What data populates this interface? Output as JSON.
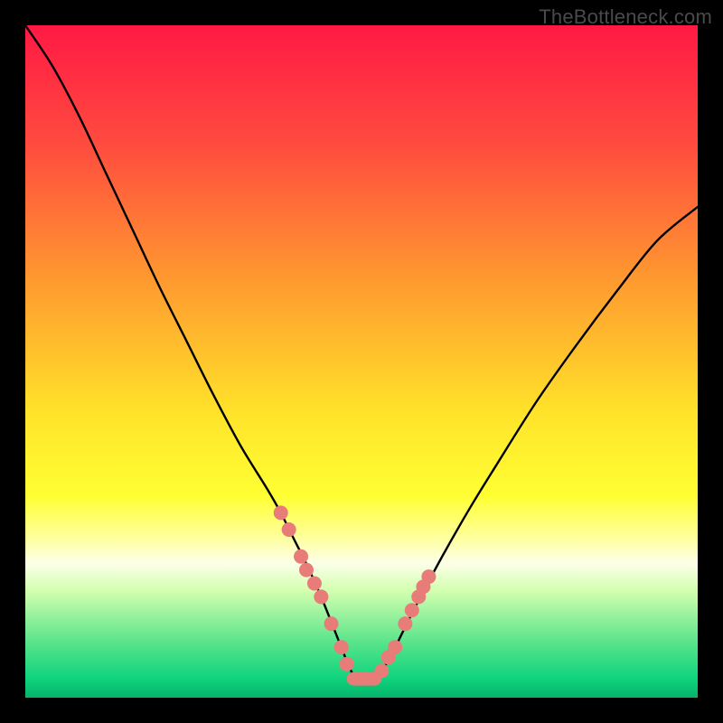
{
  "watermark": {
    "text": "TheBottleneck.com"
  },
  "chart_data": {
    "type": "line",
    "title": "",
    "xlabel": "",
    "ylabel": "",
    "xlim": [
      0,
      100
    ],
    "ylim": [
      0,
      100
    ],
    "grid": false,
    "legend": false,
    "background": {
      "kind": "vertical-gradient",
      "stops": [
        {
          "offset": 0.0,
          "color": "#ff1944"
        },
        {
          "offset": 0.18,
          "color": "#ff4c3f"
        },
        {
          "offset": 0.38,
          "color": "#ff9a2f"
        },
        {
          "offset": 0.58,
          "color": "#ffe42a"
        },
        {
          "offset": 0.7,
          "color": "#ffff33"
        },
        {
          "offset": 0.76,
          "color": "#ffff9a"
        },
        {
          "offset": 0.8,
          "color": "#fcffe8"
        },
        {
          "offset": 0.84,
          "color": "#d4ffb0"
        },
        {
          "offset": 0.92,
          "color": "#56e38a"
        },
        {
          "offset": 0.97,
          "color": "#11d47e"
        },
        {
          "offset": 1.0,
          "color": "#05b46a"
        }
      ]
    },
    "series": [
      {
        "name": "bottleneck-curve",
        "color": "#000000",
        "x": [
          0,
          4,
          8,
          12,
          16,
          20,
          24,
          28,
          32,
          36,
          38,
          40,
          42,
          44,
          46,
          48,
          49,
          50,
          51,
          52,
          54,
          56,
          58,
          62,
          66,
          70,
          76,
          82,
          88,
          94,
          100
        ],
        "values": [
          100,
          94,
          86.5,
          78,
          69.5,
          61,
          53,
          45,
          37.5,
          31,
          27.5,
          23.5,
          19.5,
          15,
          10,
          5,
          3,
          2.5,
          2.5,
          3,
          5.5,
          9.5,
          13.5,
          21,
          28,
          34.5,
          44,
          52.5,
          60.5,
          68,
          73
        ]
      }
    ],
    "markers": {
      "name": "highlight-dots",
      "color": "#e77c78",
      "radius": 8,
      "points": [
        {
          "x": 38.0,
          "y": 27.5
        },
        {
          "x": 39.2,
          "y": 25.0
        },
        {
          "x": 41.0,
          "y": 21.0
        },
        {
          "x": 41.8,
          "y": 19.0
        },
        {
          "x": 43.0,
          "y": 17.0
        },
        {
          "x": 44.0,
          "y": 15.0
        },
        {
          "x": 45.5,
          "y": 11.0
        },
        {
          "x": 47.0,
          "y": 7.5
        },
        {
          "x": 47.8,
          "y": 5.0
        },
        {
          "x": 53.0,
          "y": 4.0
        },
        {
          "x": 54.0,
          "y": 6.0
        },
        {
          "x": 55.0,
          "y": 7.5
        },
        {
          "x": 56.5,
          "y": 11.0
        },
        {
          "x": 57.5,
          "y": 13.0
        },
        {
          "x": 58.5,
          "y": 15.0
        },
        {
          "x": 59.2,
          "y": 16.5
        },
        {
          "x": 60.0,
          "y": 18.0
        }
      ]
    },
    "bottom_bar": {
      "color": "#e77c78",
      "x_start": 47.8,
      "x_end": 53.0,
      "y": 2.8,
      "thickness_pct": 2.0
    }
  }
}
